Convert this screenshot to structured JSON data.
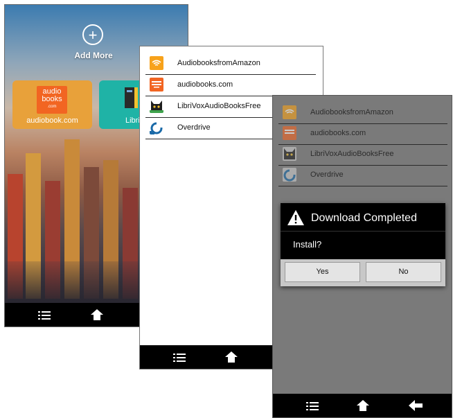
{
  "screen_home": {
    "add_more_label": "Add More",
    "tiles": [
      {
        "caption": "audiobook.com",
        "logo_text": "audio\nbooks",
        "logo_small": ".com"
      },
      {
        "caption": "Libri"
      }
    ]
  },
  "source_list": {
    "items": [
      {
        "label": "AudiobooksfromAmazon",
        "icon": "amazon-audible-icon",
        "color": "#f7a21b"
      },
      {
        "label": "audiobooks.com",
        "icon": "audiobooks-com-icon",
        "color": "#f26522"
      },
      {
        "label": "LibriVoxAudioBooksFree",
        "icon": "librivox-icon",
        "color": "#2e2e2e"
      },
      {
        "label": "Overdrive",
        "icon": "overdrive-icon",
        "color": "#1a6aa8"
      }
    ]
  },
  "dialog": {
    "title": "Download Completed",
    "message": "Install?",
    "yes_label": "Yes",
    "no_label": "No"
  },
  "navbar": {
    "menu_icon": "menu-icon",
    "home_icon": "home-icon",
    "back_icon": "back-icon"
  },
  "colors": {
    "accent_orange": "#e8a13a",
    "accent_teal": "#1fb3a6",
    "dim_overlay": "#7a7a7a"
  }
}
